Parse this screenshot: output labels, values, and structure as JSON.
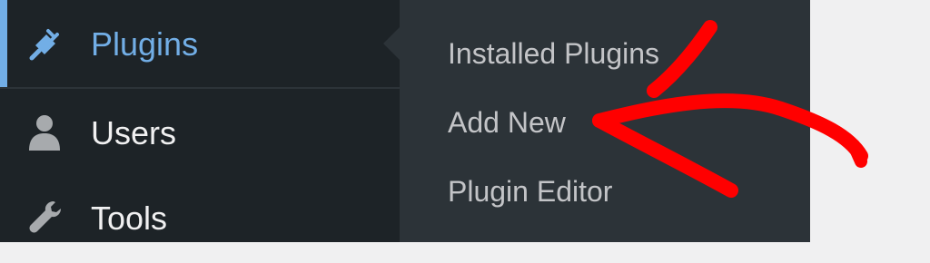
{
  "sidebar": {
    "items": [
      {
        "label": "Plugins",
        "icon": "plug-icon",
        "active": true
      },
      {
        "label": "Users",
        "icon": "user-icon",
        "active": false
      },
      {
        "label": "Tools",
        "icon": "wrench-icon",
        "active": false
      }
    ]
  },
  "submenu": {
    "items": [
      {
        "label": "Installed Plugins"
      },
      {
        "label": "Add New"
      },
      {
        "label": "Plugin Editor"
      }
    ]
  },
  "annotation": {
    "type": "arrow",
    "color": "#ff0000",
    "points_to": "Add New"
  },
  "colors": {
    "sidebar_bg": "#1d2327",
    "submenu_bg": "#2c3338",
    "active_text": "#72aee6",
    "menu_text": "#f0f0f1",
    "submenu_text": "#c3c4c7",
    "content_bg": "#f0f0f1"
  }
}
